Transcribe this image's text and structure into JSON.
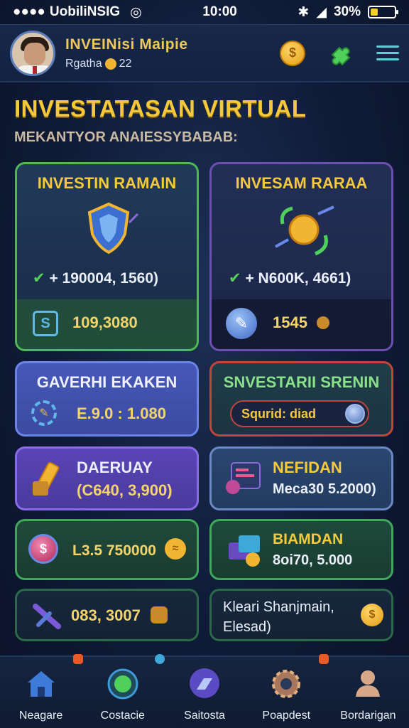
{
  "status_bar": {
    "carrier": "UobiliNSIG",
    "time": "10:00",
    "battery": "30%",
    "battery_level": 0.3
  },
  "header": {
    "user_name": "INVEINisi Maipie",
    "user_sub_label": "Rgatha",
    "user_sub_value": "22",
    "coin_symbol": "$"
  },
  "page": {
    "title": "INVESTATASAN VIRTUAL",
    "subtitle": "MEKANTYOR ANAIESSYBABAB:"
  },
  "cards": {
    "a": {
      "title": "INVESTIN RAMAIN",
      "stat": "+ 190004, 1560)",
      "value": "109,3080"
    },
    "b": {
      "title": "INVESAM RARAA",
      "stat": "+ N600K, 4661)",
      "value": "1545"
    },
    "c": {
      "title": "GAVERHI EKAKEN",
      "value": "E.9.0 : 1.080"
    },
    "d": {
      "title": "SNVESTARII SRENIN",
      "toggle_label": "Squrid: diad"
    },
    "e": {
      "title": "DAERUAY",
      "value": "(C640, 3,900)"
    },
    "f": {
      "title": "NEFIDAN",
      "value": "Meca30 5.2000)"
    },
    "g": {
      "value": "L3.5 750000"
    },
    "h": {
      "title": "BIAMDAN",
      "value": "8oi70, 5.000"
    },
    "i": {
      "value": "083, 3007"
    },
    "j": {
      "line1": "Kleari Shanjmain,",
      "line2": "Elesad)"
    }
  },
  "bottom_nav": {
    "items": [
      {
        "label": "Neagare"
      },
      {
        "label": "Costacie"
      },
      {
        "label": "Saitosta"
      },
      {
        "label": "Poapdest"
      },
      {
        "label": "Bordarigan"
      }
    ]
  },
  "colors": {
    "accent_gold": "#f5c93b",
    "positive_green": "#58d05a",
    "card_green": "#4fb856",
    "card_purple": "#6d4fb0",
    "card_red": "#c0453a"
  }
}
